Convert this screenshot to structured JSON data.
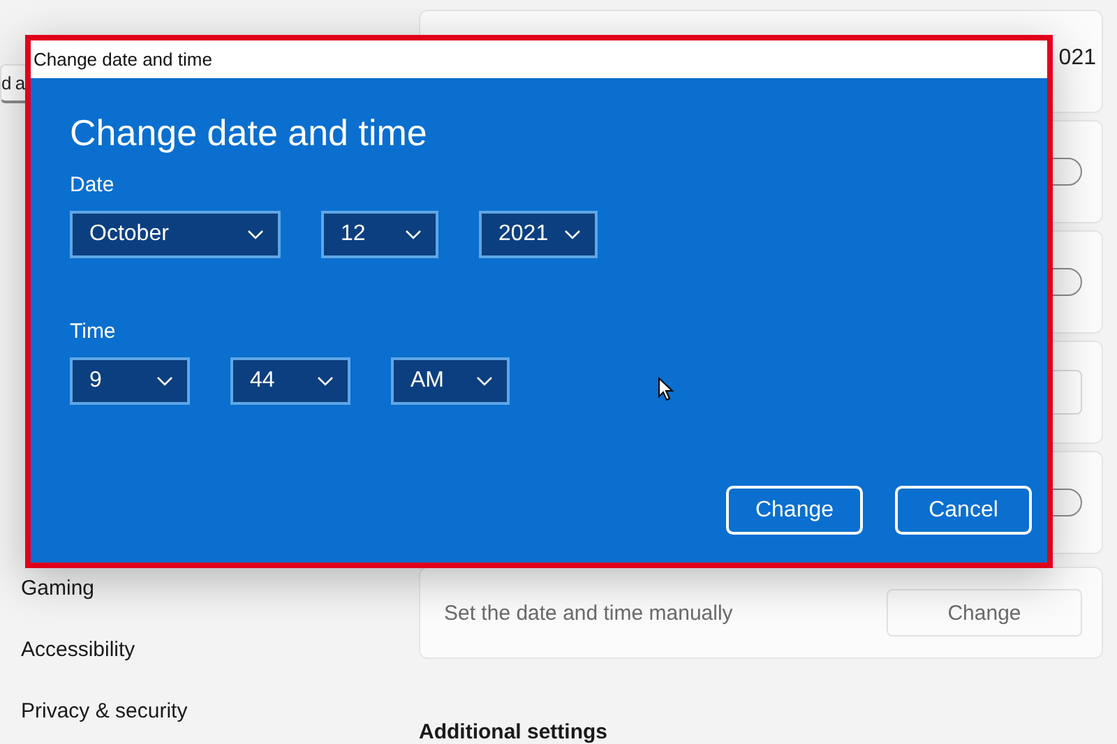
{
  "sidebar": {
    "search_text": "d a",
    "items": [
      {
        "label": "Gaming"
      },
      {
        "label": "Accessibility"
      },
      {
        "label": "Privacy & security"
      }
    ]
  },
  "settings_cards": [
    {
      "kind": "value",
      "text": "021"
    },
    {
      "kind": "toggle",
      "on": false
    },
    {
      "kind": "toggle",
      "on": false
    },
    {
      "kind": "dropdown"
    },
    {
      "kind": "toggle",
      "on": false
    },
    {
      "kind": "action",
      "label": "Set the date and time manually",
      "button": "Change"
    }
  ],
  "section_heading": "Additional settings",
  "dialog": {
    "window_title": "Change date and time",
    "heading": "Change date and time",
    "date_label": "Date",
    "date_fields": [
      "October",
      "12",
      "2021"
    ],
    "time_label": "Time",
    "time_fields": [
      "9",
      "44",
      "AM"
    ],
    "buttons": [
      "Change",
      "Cancel"
    ]
  }
}
